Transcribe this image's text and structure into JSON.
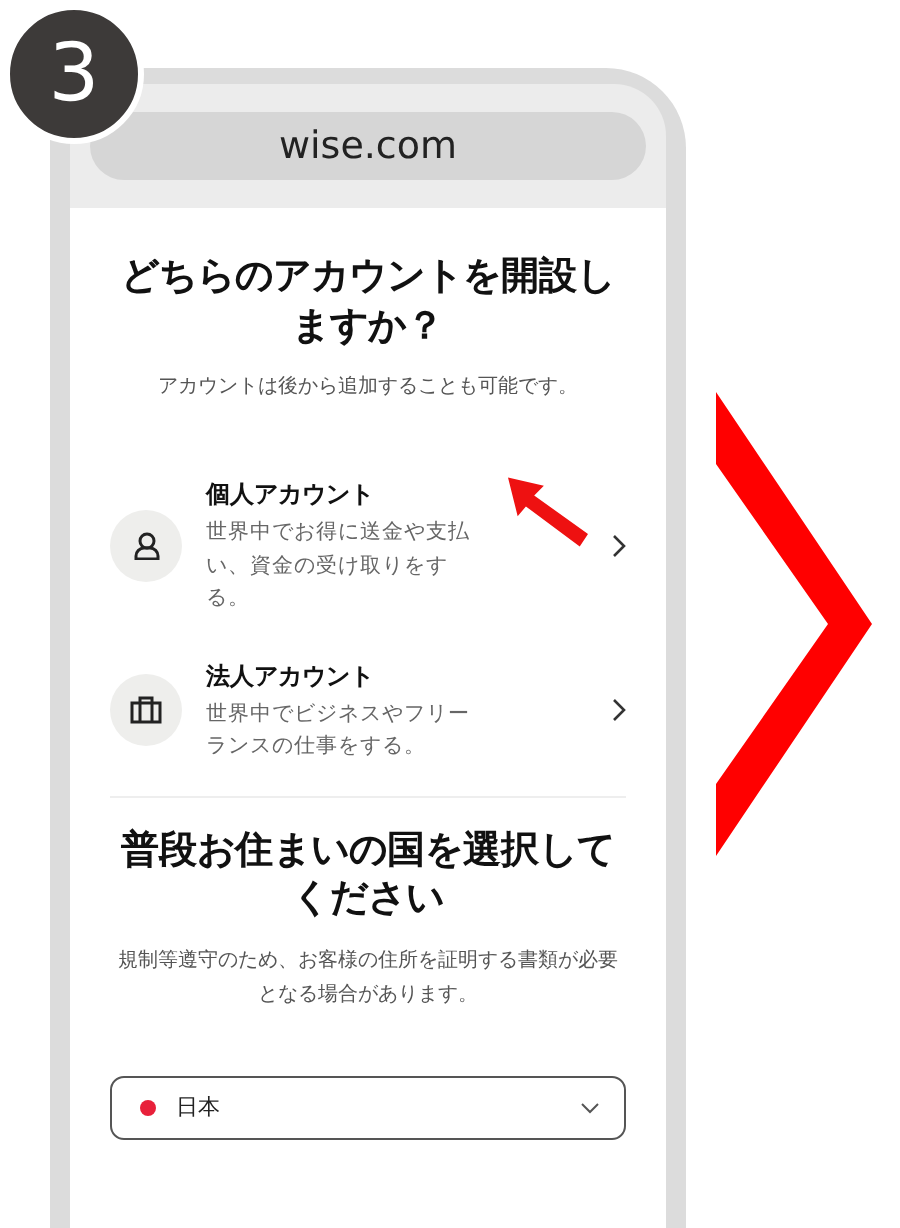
{
  "step_badge": "3",
  "browser": {
    "url": "wise.com"
  },
  "account_section": {
    "title": "どちらのアカウントを開設しますか？",
    "subtitle": "アカウントは後から追加することも可能です。",
    "options": [
      {
        "kind": "person",
        "title": "個人アカウント",
        "description": "世界中でお得に送金や支払い、資金の受け取りをする。",
        "pointed_at": true
      },
      {
        "kind": "business",
        "title": "法人アカウント",
        "description": "世界中でビジネスやフリーランスの仕事をする。",
        "pointed_at": false
      }
    ]
  },
  "country_section": {
    "title": "普段お住まいの国を選択してください",
    "note": "規制等遵守のため、お客様の住所を証明する書類が必要となる場合があります。",
    "select": {
      "value": "日本"
    }
  }
}
